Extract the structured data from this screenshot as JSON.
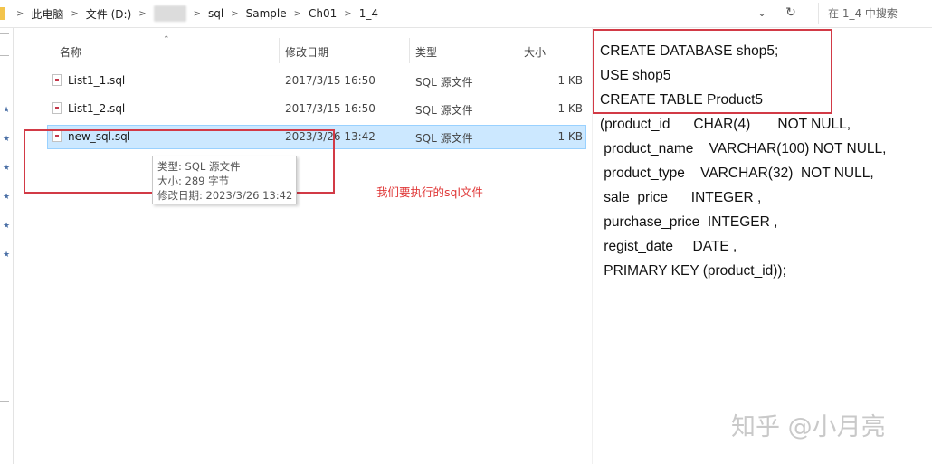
{
  "address": {
    "crumbs": [
      "此电脑",
      "文件 (D:)",
      "",
      "sql",
      "Sample",
      "Ch01",
      "1_4"
    ],
    "dropdown_icon": "chevron-down-icon",
    "refresh_icon": "refresh-icon",
    "search_placeholder": "在 1_4 中搜索"
  },
  "list": {
    "headers": {
      "name": "名称",
      "date": "修改日期",
      "type": "类型",
      "size": "大小"
    },
    "files": [
      {
        "name": "List1_1.sql",
        "date": "2017/3/15 16:50",
        "type": "SQL 源文件",
        "size": "1 KB"
      },
      {
        "name": "List1_2.sql",
        "date": "2017/3/15 16:50",
        "type": "SQL 源文件",
        "size": "1 KB"
      },
      {
        "name": "new_sql.sql",
        "date": "2023/3/26 13:42",
        "type": "SQL 源文件",
        "size": "1 KB",
        "selected": true
      }
    ]
  },
  "tooltip": {
    "type_line": "类型: SQL 源文件",
    "size_line": "大小: 289 字节",
    "date_line": "修改日期: 2023/3/26 13:42"
  },
  "annotation": {
    "label": "我们要执行的sql文件",
    "color": "#d23a46"
  },
  "sql": {
    "lines": [
      "CREATE DATABASE shop5;",
      "USE shop5",
      "CREATE TABLE Product5",
      "(product_id      CHAR(4)       NOT NULL,",
      " product_name    VARCHAR(100) NOT NULL,",
      " product_type    VARCHAR(32)  NOT NULL,",
      " sale_price      INTEGER ,",
      " purchase_price  INTEGER ,",
      " regist_date     DATE ,",
      " PRIMARY KEY (product_id));"
    ]
  },
  "watermark": "知乎 @小月亮",
  "colors": {
    "selection": "#cce8ff",
    "selection_border": "#99d1ff",
    "annotation_text": "#e03a3a"
  }
}
